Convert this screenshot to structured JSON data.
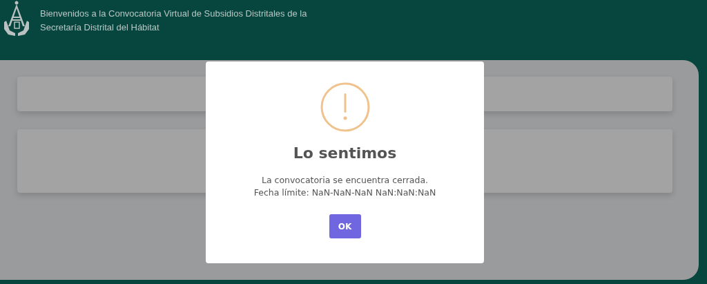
{
  "header": {
    "title_lines": [
      "Bienvenidos a la Convocatoria Virtual de Subsidios Distritales de la",
      "Secretaría Distrital del Hábitat"
    ]
  },
  "dialog": {
    "title": "Lo sentimos",
    "message_lines": [
      "La convocatoria se encuentra cerrada.",
      "Fecha límite: NaN-NaN-NaN NaN:NaN:NaN"
    ],
    "button": "OK"
  }
}
